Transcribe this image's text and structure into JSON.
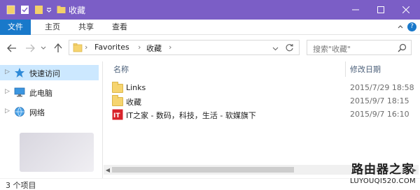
{
  "window": {
    "title": "收藏",
    "accent_color": "#7b5ec6",
    "controls": {
      "minimize": "minimize-icon",
      "maximize": "maximize-icon",
      "close": "close-icon"
    }
  },
  "ribbon": {
    "tabs": [
      {
        "label": "文件",
        "active": true
      },
      {
        "label": "主页"
      },
      {
        "label": "共享"
      },
      {
        "label": "查看"
      }
    ],
    "file_tab_color": "#1979ca"
  },
  "address": {
    "segments": [
      "Favorites",
      "收藏"
    ]
  },
  "search": {
    "placeholder": "搜索\"收藏\""
  },
  "sidebar": {
    "items": [
      {
        "label": "快速访问",
        "icon": "star-icon",
        "selected": true
      },
      {
        "label": "此电脑",
        "icon": "computer-icon",
        "selected": false
      },
      {
        "label": "网络",
        "icon": "network-icon",
        "selected": false
      }
    ]
  },
  "list": {
    "columns": {
      "name": "名称",
      "modified": "修改日期"
    },
    "rows": [
      {
        "name": "Links",
        "date": "2015/7/29 18:58",
        "icon": "folder-icon"
      },
      {
        "name": "收藏",
        "date": "2015/9/7 18:15",
        "icon": "folder-icon"
      },
      {
        "name": "IT之家 - 数码，科技，生活 - 软媒旗下",
        "date": "2015/9/7 16:10",
        "icon": "web-shortcut-icon"
      }
    ]
  },
  "status": {
    "item_count": "3 个项目"
  },
  "watermark": {
    "name": "路由器之家",
    "url": "LUYOUQI520.COM"
  }
}
